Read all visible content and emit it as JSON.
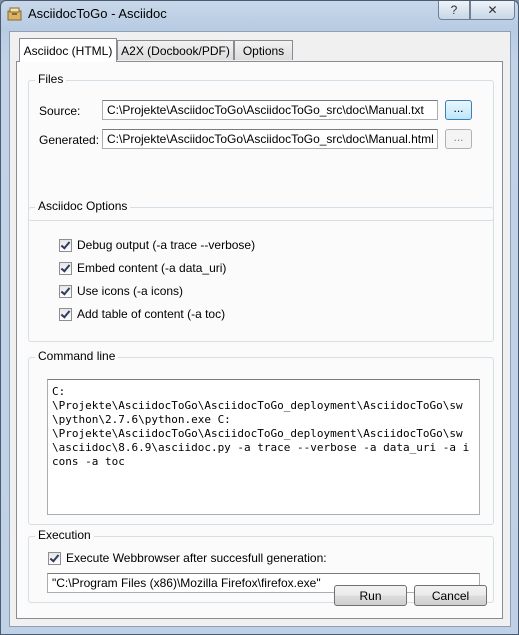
{
  "window": {
    "title": "AsciidocToGo - Asciidoc",
    "help_glyph": "?",
    "close_glyph": "✕"
  },
  "tabs": [
    {
      "label": "Asciidoc (HTML)",
      "active": true
    },
    {
      "label": "A2X (Docbook/PDF)",
      "active": false
    },
    {
      "label": "Options",
      "active": false
    }
  ],
  "files": {
    "title": "Files",
    "source_label": "Source:",
    "source_value": "C:\\Projekte\\AsciidocToGo\\AsciidocToGo_src\\doc\\Manual.txt",
    "generated_label": "Generated:",
    "generated_value": "C:\\Projekte\\AsciidocToGo\\AsciidocToGo_src\\doc\\Manual.html",
    "browse_label": "..."
  },
  "options": {
    "title": "Asciidoc Options",
    "items": [
      {
        "label": "Debug output  (-a trace --verbose)",
        "checked": true
      },
      {
        "label": "Embed content (-a data_uri)",
        "checked": true
      },
      {
        "label": "Use icons (-a icons)",
        "checked": true
      },
      {
        "label": "Add table of content (-a toc)",
        "checked": true
      }
    ]
  },
  "command": {
    "title": "Command line",
    "text": "C:\n\\Projekte\\AsciidocToGo\\AsciidocToGo_deployment\\AsciidocToGo\\sw\\python\\2.7.6\\python.exe C:\n\\Projekte\\AsciidocToGo\\AsciidocToGo_deployment\\AsciidocToGo\\sw\\asciidoc\\8.6.9\\asciidoc.py -a trace --verbose -a data_uri -a icons -a toc"
  },
  "execution": {
    "title": "Execution",
    "checkbox_label": "Execute Webbrowser after succesfull generation:",
    "checked": true,
    "browser_path": "\"C:\\Program Files (x86)\\Mozilla Firefox\\firefox.exe\""
  },
  "buttons": {
    "run": "Run",
    "cancel": "Cancel"
  },
  "colors": {
    "titlebar": "#b7cbe3",
    "focus_border": "#3c7fb1"
  }
}
